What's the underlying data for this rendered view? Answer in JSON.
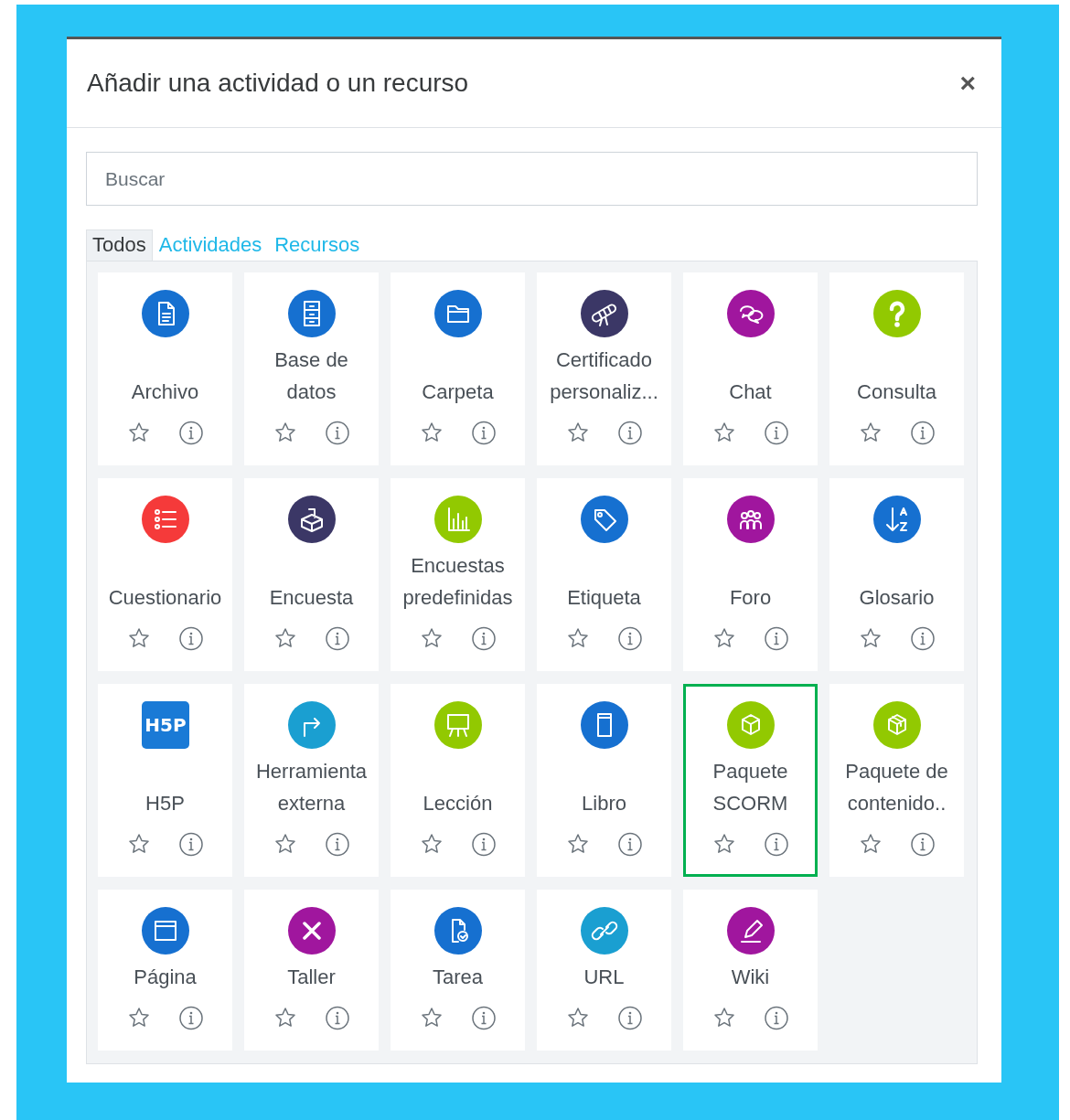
{
  "dialog": {
    "title": "Añadir una actividad o un recurso",
    "close": "×"
  },
  "search": {
    "placeholder": "Buscar"
  },
  "tabs": [
    {
      "label": "Todos",
      "selected": true
    },
    {
      "label": "Actividades",
      "selected": false
    },
    {
      "label": "Recursos",
      "selected": false
    }
  ],
  "items": [
    {
      "label": "Archivo",
      "color": "#1670d0",
      "selected": false,
      "starred": false
    },
    {
      "label": "Base de datos",
      "color": "#1670d0",
      "selected": false,
      "starred": false
    },
    {
      "label": "Carpeta",
      "color": "#1670d0",
      "selected": false,
      "starred": false
    },
    {
      "label": "Certificado personaliz...",
      "color": "#3b3766",
      "selected": false,
      "starred": false
    },
    {
      "label": "Chat",
      "color": "#a0169e",
      "selected": false,
      "starred": false
    },
    {
      "label": "Consulta",
      "color": "#92c901",
      "selected": false,
      "starred": false
    },
    {
      "label": "Cuestionario",
      "color": "#f53a3a",
      "selected": false,
      "starred": false
    },
    {
      "label": "Encuesta",
      "color": "#3b3766",
      "selected": false,
      "starred": false
    },
    {
      "label": "Encuestas predefinidas",
      "color": "#92c901",
      "selected": false,
      "starred": false
    },
    {
      "label": "Etiqueta",
      "color": "#1670d0",
      "selected": false,
      "starred": false
    },
    {
      "label": "Foro",
      "color": "#a0169e",
      "selected": false,
      "starred": false
    },
    {
      "label": "Glosario",
      "color": "#1670d0",
      "selected": false,
      "starred": false
    },
    {
      "label": "H5P",
      "logo_text": "H5P",
      "color": "#1a7ad6",
      "selected": false,
      "starred": false
    },
    {
      "label": "Herramienta externa",
      "color": "#1a9fd1",
      "selected": false,
      "starred": false
    },
    {
      "label": "Lección",
      "color": "#92c901",
      "selected": false,
      "starred": false
    },
    {
      "label": "Libro",
      "color": "#1670d0",
      "selected": false,
      "starred": false
    },
    {
      "label": "Paquete SCORM",
      "color": "#92c901",
      "selected": true,
      "starred": false
    },
    {
      "label": "Paquete de contenido..",
      "color": "#92c901",
      "selected": false,
      "starred": false
    },
    {
      "label": "Página",
      "color": "#1670d0",
      "selected": false,
      "starred": false
    },
    {
      "label": "Taller",
      "color": "#a0169e",
      "selected": false,
      "starred": false
    },
    {
      "label": "Tarea",
      "color": "#1670d0",
      "selected": false,
      "starred": false
    },
    {
      "label": "URL",
      "color": "#1a9fd1",
      "selected": false,
      "starred": false
    },
    {
      "label": "Wiki",
      "color": "#a0169e",
      "selected": false,
      "starred": false
    }
  ]
}
